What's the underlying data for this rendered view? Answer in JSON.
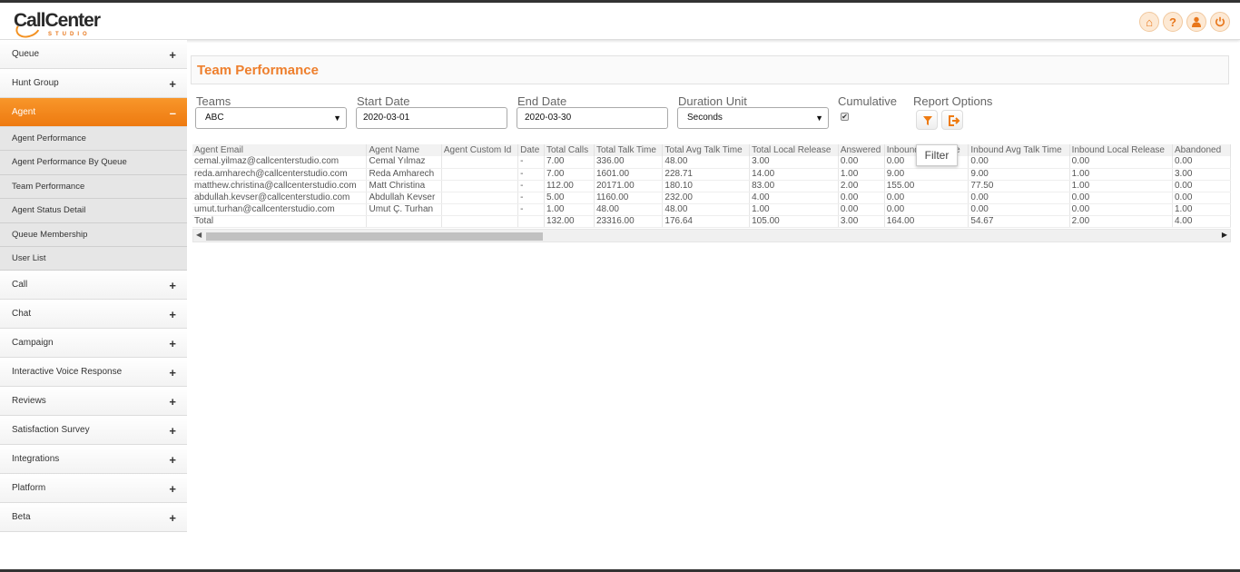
{
  "brand": {
    "name": "CallCenter",
    "sub": "STUDIO"
  },
  "header_icons": [
    {
      "name": "home-icon",
      "glyph": "⌂"
    },
    {
      "name": "help-icon",
      "glyph": "?"
    },
    {
      "name": "user-icon",
      "glyph": "👤"
    },
    {
      "name": "power-icon",
      "glyph": "⏻"
    }
  ],
  "sidebar": {
    "queue": "Queue",
    "hunt_group": "Hunt Group",
    "agent": "Agent",
    "agent_subs": [
      "Agent Performance",
      "Agent Performance By Queue",
      "Team Performance",
      "Agent Status Detail",
      "Queue Membership",
      "User List"
    ],
    "bottom": [
      "Call",
      "Chat",
      "Campaign",
      "Interactive Voice Response",
      "Reviews",
      "Satisfaction Survey",
      "Integrations",
      "Platform",
      "Beta"
    ],
    "plus": "+",
    "minus": "–"
  },
  "page_title": "Team Performance",
  "filters": {
    "teams_label": "Teams",
    "teams_value": "ABC",
    "start_label": "Start Date",
    "start_value": "2020-03-01",
    "end_label": "End Date",
    "end_value": "2020-03-30",
    "duration_label": "Duration Unit",
    "duration_value": "Seconds",
    "cumulative_label": "Cumulative",
    "report_label": "Report Options",
    "select_arrow": "▼",
    "check_mark": "✔"
  },
  "tooltip": "Filter",
  "table": {
    "columns": [
      "Agent Email",
      "Agent Name",
      "Agent Custom Id",
      "Date",
      "Total Calls",
      "Total Talk Time",
      "Total Avg Talk Time",
      "Total Local Release",
      "Answered",
      "Inbound Talk Time",
      "Inbound Avg Talk Time",
      "Inbound Local Release",
      "Abandoned"
    ],
    "rows": [
      [
        "cemal.yilmaz@callcenterstudio.com",
        "Cemal Yılmaz",
        "",
        "-",
        "7.00",
        "336.00",
        "48.00",
        "3.00",
        "0.00",
        "0.00",
        "0.00",
        "0.00",
        "0.00"
      ],
      [
        "reda.amharech@callcenterstudio.com",
        "Reda Amharech",
        "",
        "-",
        "7.00",
        "1601.00",
        "228.71",
        "14.00",
        "1.00",
        "9.00",
        "9.00",
        "1.00",
        "3.00"
      ],
      [
        "matthew.christina@callcenterstudio.com",
        "Matt Christina",
        "",
        "-",
        "112.00",
        "20171.00",
        "180.10",
        "83.00",
        "2.00",
        "155.00",
        "77.50",
        "1.00",
        "0.00"
      ],
      [
        "abdullah.kevser@callcenterstudio.com",
        "Abdullah Kevser",
        "",
        "-",
        "5.00",
        "1160.00",
        "232.00",
        "4.00",
        "0.00",
        "0.00",
        "0.00",
        "0.00",
        "0.00"
      ],
      [
        "umut.turhan@callcenterstudio.com",
        "Umut Ç. Turhan",
        "",
        "-",
        "1.00",
        "48.00",
        "48.00",
        "1.00",
        "0.00",
        "0.00",
        "0.00",
        "0.00",
        "1.00"
      ],
      [
        "Total",
        "",
        "",
        "",
        "132.00",
        "23316.00",
        "176.64",
        "105.00",
        "3.00",
        "164.00",
        "54.67",
        "2.00",
        "4.00"
      ]
    ]
  },
  "scroll": {
    "left": "◀",
    "right": "▶"
  },
  "colors": {
    "accent": "#ee7a10",
    "title": "#ee7f2d"
  }
}
